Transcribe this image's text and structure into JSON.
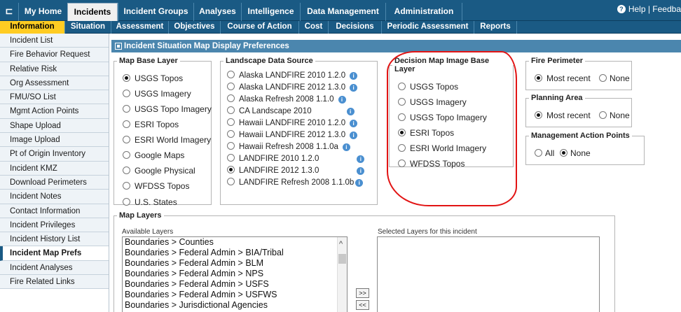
{
  "topnav": {
    "corner_icon": "minimize-icon",
    "tabs": [
      {
        "label": "My Home"
      },
      {
        "label": "Incidents"
      },
      {
        "label": "Incident Groups"
      },
      {
        "label": "Analyses"
      },
      {
        "label": "Intelligence"
      },
      {
        "label": "Data Management"
      },
      {
        "label": "Administration"
      }
    ],
    "help_label": "Help | Feedba"
  },
  "subnav": {
    "tabs": [
      {
        "label": "Information"
      },
      {
        "label": "Situation"
      },
      {
        "label": "Assessment"
      },
      {
        "label": "Objectives"
      },
      {
        "label": "Course of Action"
      },
      {
        "label": "Cost"
      },
      {
        "label": "Decisions"
      },
      {
        "label": "Periodic Assessment"
      },
      {
        "label": "Reports"
      }
    ]
  },
  "sidebar": {
    "items": [
      {
        "label": "Incident List"
      },
      {
        "label": "Fire Behavior Request"
      },
      {
        "label": "Relative Risk"
      },
      {
        "label": "Org Assessment"
      },
      {
        "label": "FMU/SO List"
      },
      {
        "label": "Mgmt Action Points"
      },
      {
        "label": "Shape Upload"
      },
      {
        "label": "Image Upload"
      },
      {
        "label": "Pt of Origin Inventory"
      },
      {
        "label": "Incident KMZ"
      },
      {
        "label": "Download Perimeters"
      },
      {
        "label": "Incident Notes"
      },
      {
        "label": "Contact Information"
      },
      {
        "label": "Incident Privileges"
      },
      {
        "label": "Incident History List"
      },
      {
        "label": "Incident Map Prefs"
      },
      {
        "label": "Incident Analyses"
      },
      {
        "label": "Fire Related Links"
      }
    ]
  },
  "panel": {
    "title": "Incident Situation Map Display Preferences",
    "map_base_layer": {
      "legend": "Map Base Layer",
      "options": [
        "USGS Topos",
        "USGS Imagery",
        "USGS Topo Imagery",
        "ESRI Topos",
        "ESRI World Imagery",
        "Google Maps",
        "Google Physical",
        "WFDSS Topos",
        "U.S. States"
      ],
      "selected": "USGS Topos"
    },
    "landscape_data_source": {
      "legend": "Landscape Data Source",
      "options": [
        "Alaska LANDFIRE 2010 1.2.0",
        "Alaska LANDFIRE 2012 1.3.0",
        "Alaska Refresh 2008 1.1.0",
        "CA Landscape 2010",
        "Hawaii LANDFIRE 2010 1.2.0",
        "Hawaii LANDFIRE 2012 1.3.0",
        "Hawaii Refresh 2008 1.1.0a",
        "LANDFIRE 2010 1.2.0",
        "LANDFIRE 2012 1.3.0",
        "LANDFIRE Refresh 2008 1.1.0b"
      ],
      "selected": "LANDFIRE 2012 1.3.0"
    },
    "decision_map_base_layer": {
      "legend": "Decision Map Image Base Layer",
      "options": [
        "USGS Topos",
        "USGS Imagery",
        "USGS Topo Imagery",
        "ESRI Topos",
        "ESRI World Imagery",
        "WFDSS Topos"
      ],
      "selected": "ESRI Topos"
    },
    "fire_perimeter": {
      "legend": "Fire Perimeter",
      "options": [
        "Most recent",
        "None"
      ],
      "selected": "Most recent"
    },
    "planning_area": {
      "legend": "Planning Area",
      "options": [
        "Most recent",
        "None"
      ],
      "selected": "Most recent"
    },
    "management_action_points": {
      "legend": "Management Action Points",
      "options": [
        "All",
        "None"
      ],
      "selected": "None"
    },
    "map_layers": {
      "legend": "Map Layers",
      "available_label": "Available Layers",
      "selected_label": "Selected Layers for this incident",
      "available": [
        "Boundaries > Counties",
        "Boundaries > Federal Admin > BIA/Tribal",
        "Boundaries > Federal Admin > BLM",
        "Boundaries > Federal Admin > NPS",
        "Boundaries > Federal Admin > USFS",
        "Boundaries > Federal Admin > USFWS",
        "Boundaries > Jurisdictional Agencies"
      ],
      "add_label": ">>",
      "remove_label": "<<"
    }
  },
  "colors": {
    "nav_blue": "#1a5a84",
    "header_blue": "#4b86ae",
    "active_subtab": "#ffcc22",
    "annotation_red": "#e21414"
  }
}
